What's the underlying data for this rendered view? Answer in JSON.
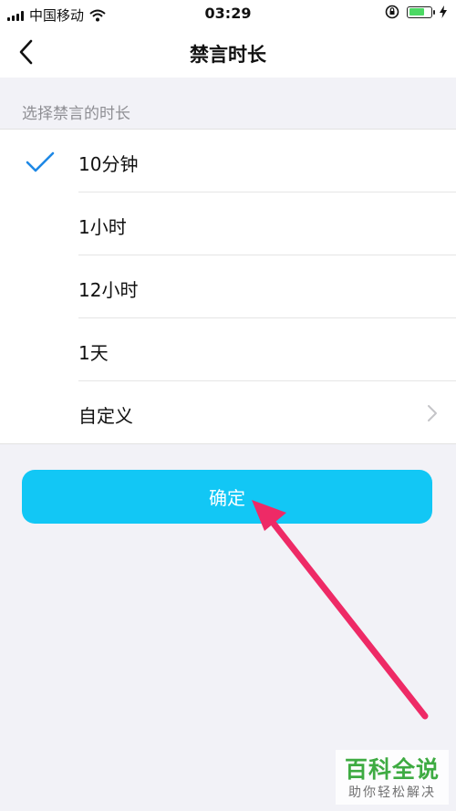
{
  "status_bar": {
    "carrier": "中国移动",
    "time": "03:29",
    "battery_level": 0.75
  },
  "nav": {
    "title": "禁言时长"
  },
  "section_label": "选择禁言的时长",
  "options": [
    {
      "label": "10分钟",
      "selected": true
    },
    {
      "label": "1小时",
      "selected": false
    },
    {
      "label": "12小时",
      "selected": false
    },
    {
      "label": "1天",
      "selected": false
    },
    {
      "label": "自定义",
      "selected": false,
      "has_chevron": true
    }
  ],
  "confirm_label": "确定",
  "watermark": {
    "main": "百科全说",
    "sub": "助你轻松解决"
  },
  "colors": {
    "accent": "#12c7f5",
    "check": "#1e88e5",
    "annotation_arrow": "#ee2a66",
    "battery": "#4cd964",
    "watermark": "#2fa533"
  }
}
